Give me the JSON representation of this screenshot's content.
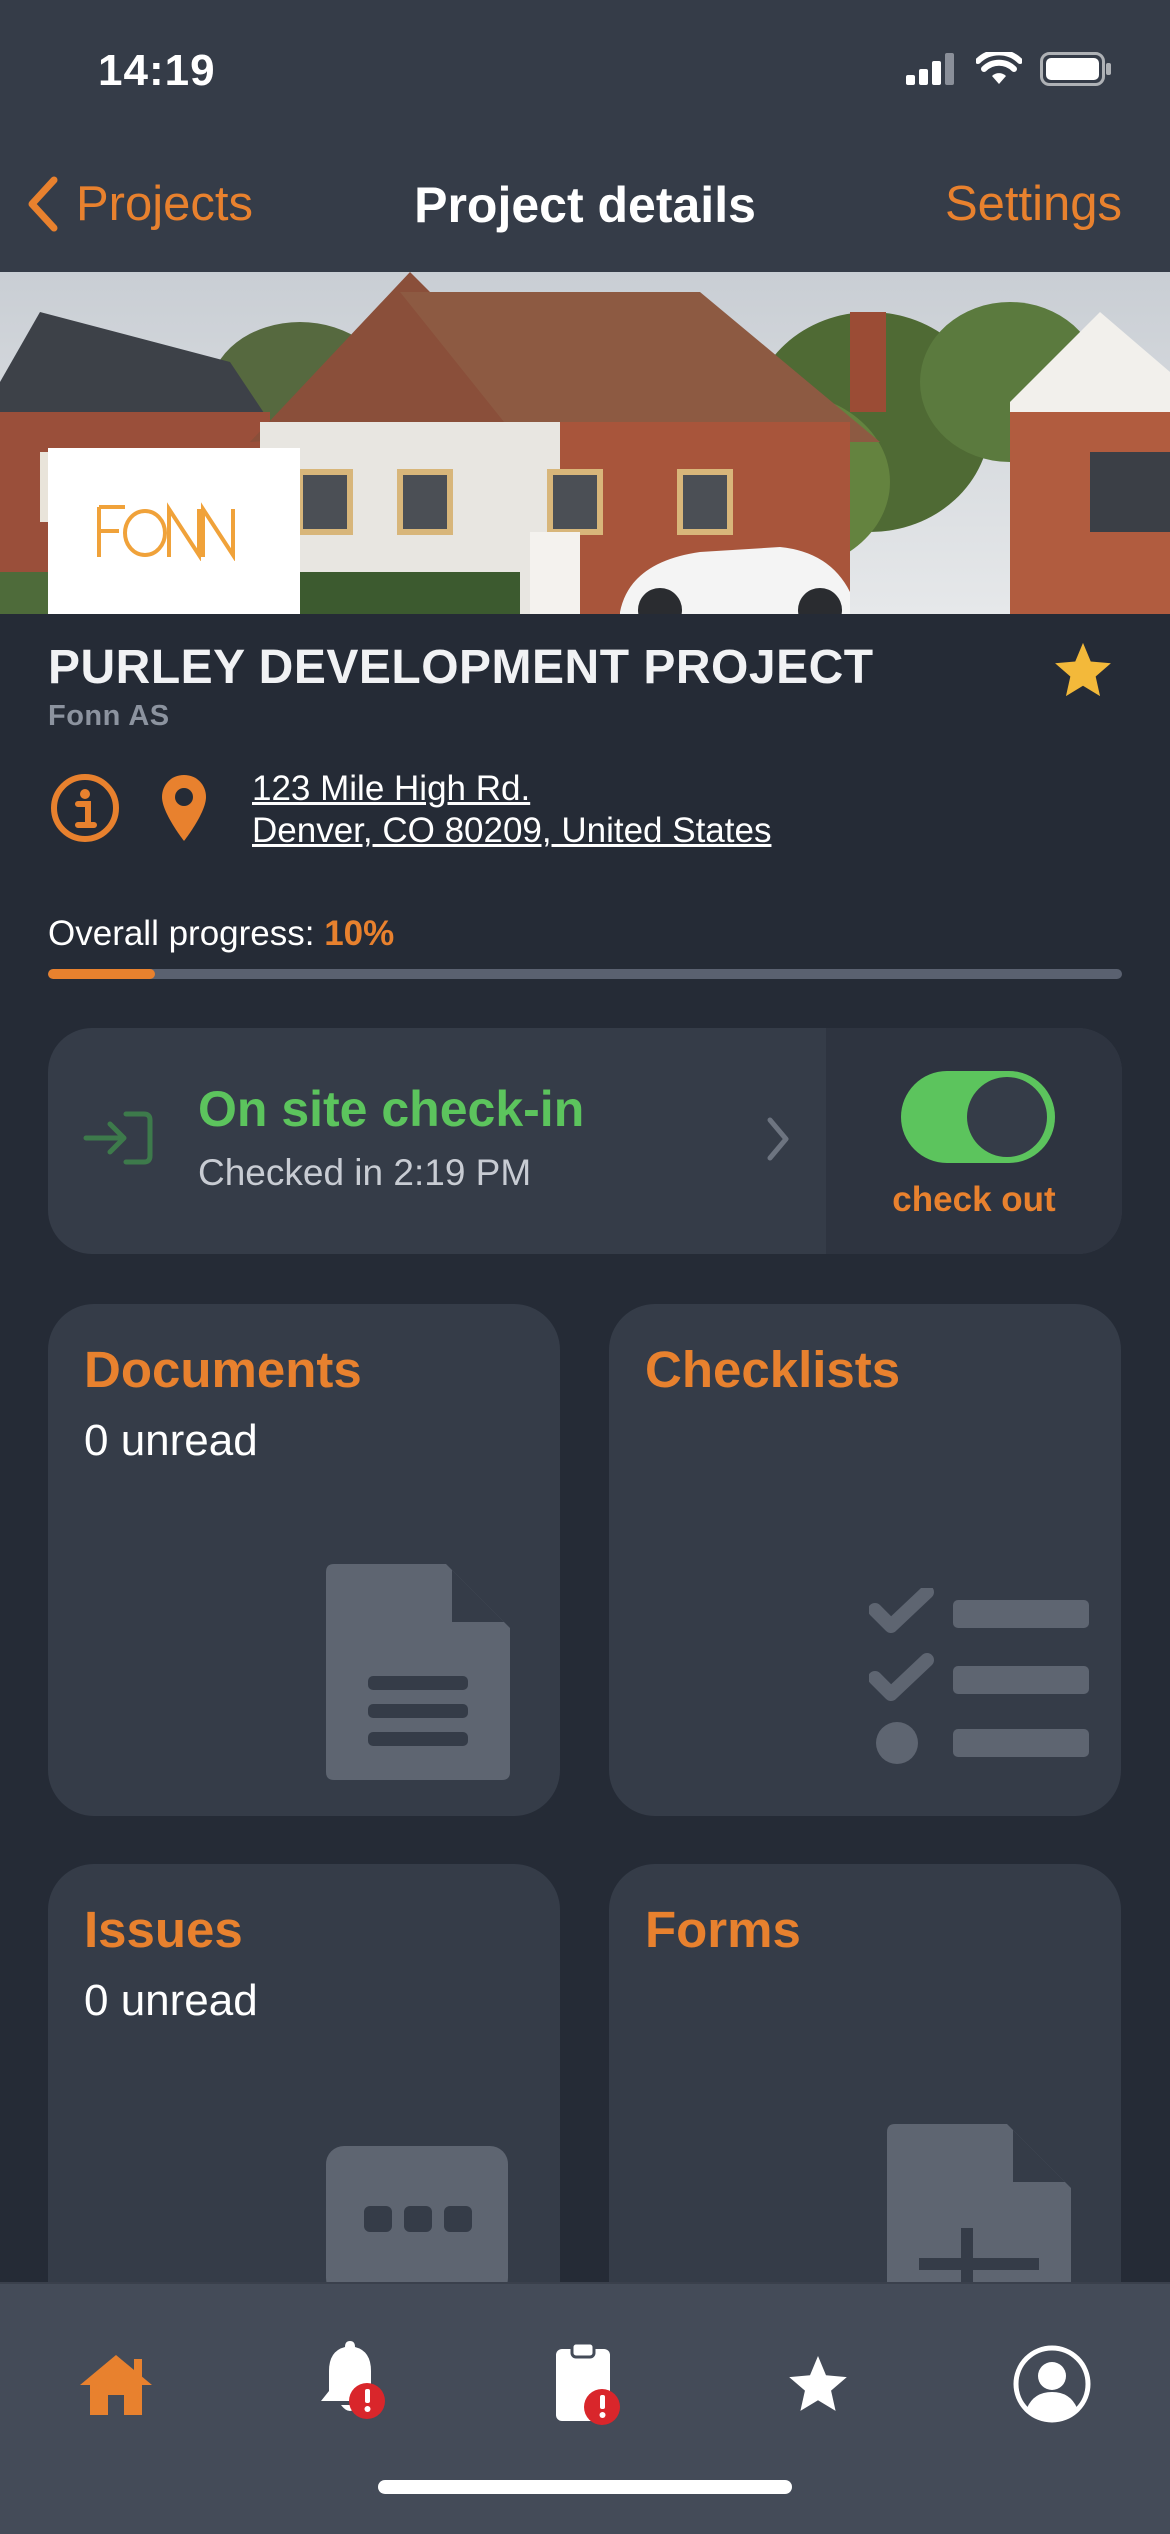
{
  "status_bar": {
    "time": "14:19"
  },
  "nav": {
    "back_label": "Projects",
    "title": "Project details",
    "settings_label": "Settings"
  },
  "project": {
    "logo_text": "FONN",
    "title": "PURLEY DEVELOPMENT PROJECT",
    "company": "Fonn AS",
    "address_line1": "123 Mile High Rd.",
    "address_line2": "Denver, CO 80209, United States",
    "favorite": true
  },
  "progress": {
    "label": "Overall progress:",
    "value_text": "10%",
    "value": 0.1
  },
  "checkin": {
    "title": "On site check-in",
    "subtitle": "Checked in 2:19 PM",
    "toggle_on": true,
    "toggle_label": "check out"
  },
  "tiles": [
    {
      "title": "Documents",
      "subtitle": "0 unread",
      "icon": "document-icon"
    },
    {
      "title": "Checklists",
      "subtitle": "",
      "icon": "checklist-icon"
    },
    {
      "title": "Issues",
      "subtitle": "0 unread",
      "icon": "chat-bubble-icon"
    },
    {
      "title": "Forms",
      "subtitle": "",
      "icon": "form-icon"
    }
  ],
  "tabbar": {
    "items": [
      {
        "name": "home-icon",
        "active": true
      },
      {
        "name": "notifications-icon",
        "badge": true
      },
      {
        "name": "tasks-icon",
        "badge": true
      },
      {
        "name": "favorites-icon"
      },
      {
        "name": "profile-icon"
      }
    ]
  },
  "colors": {
    "accent": "#e8812e",
    "success": "#5cc45d",
    "background": "#252b36",
    "card": "#353c48",
    "badge": "#d9262b"
  }
}
